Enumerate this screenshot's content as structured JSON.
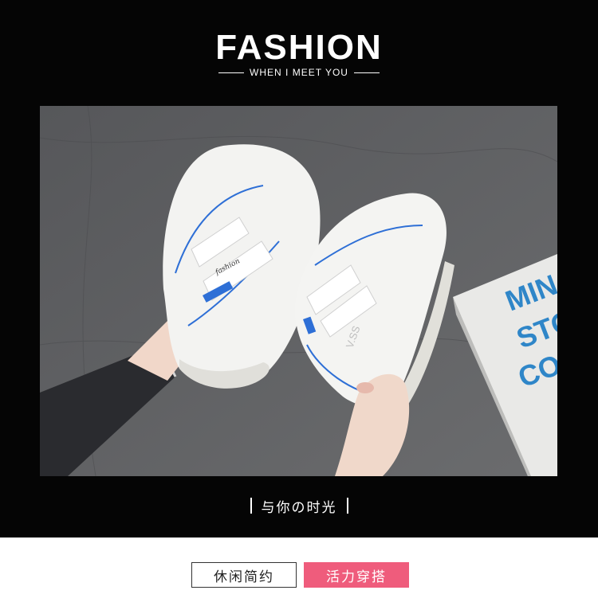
{
  "header": {
    "title": "FASHION",
    "subtitle": "WHEN I MEET YOU"
  },
  "photo": {
    "book_cover_text": [
      "MIN",
      "STO",
      "CO"
    ],
    "shoe_tag_text": "fashion",
    "shoe_side_text": "V.SS"
  },
  "caption": {
    "text": "与你の时光"
  },
  "tags": {
    "casual_label": "休闲简约",
    "active_label": "活力穿搭"
  },
  "colors": {
    "background_dark": "#050505",
    "floor_gray": "#5f5f61",
    "accent_pink": "#ef5c7c",
    "shoe_blue_trim": "#2e6fd6",
    "book_blue_text": "#2f86c8"
  }
}
